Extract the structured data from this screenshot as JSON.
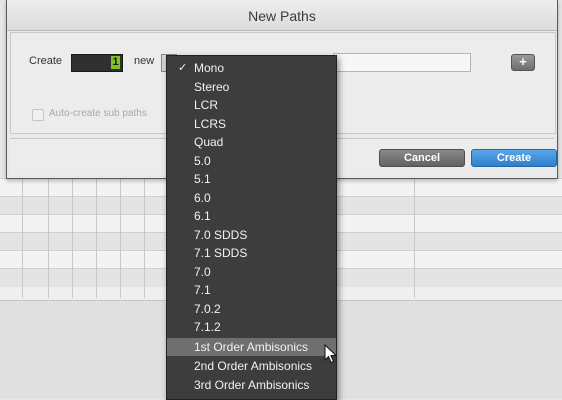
{
  "dialog": {
    "title": "New Paths",
    "create_label": "Create",
    "count_value": "1",
    "new_label": "new",
    "subpaths_label": "Auto-create sub paths",
    "add_button": "+",
    "cancel_label": "Cancel",
    "create_button_label": "Create"
  },
  "menu": {
    "selected": "Mono",
    "highlighted": "1st Order Ambisonics",
    "items": [
      {
        "label": "Mono",
        "checked": true
      },
      {
        "label": "Stereo"
      },
      {
        "label": "LCR"
      },
      {
        "label": "LCRS"
      },
      {
        "label": "Quad"
      },
      {
        "label": "5.0"
      },
      {
        "label": "5.1"
      },
      {
        "label": "6.0"
      },
      {
        "label": "6.1"
      },
      {
        "label": "7.0 SDDS"
      },
      {
        "label": "7.1 SDDS"
      },
      {
        "label": "7.0"
      },
      {
        "label": "7.1"
      },
      {
        "label": "7.0.2"
      },
      {
        "label": "7.1.2"
      },
      {
        "label": "1st Order Ambisonics"
      },
      {
        "label": "2nd Order Ambisonics"
      },
      {
        "label": "3rd Order Ambisonics"
      }
    ]
  },
  "colors": {
    "count_accent": "#7fc41d",
    "create_button": "#2f7fcf",
    "menu_background": "#3d3d3d",
    "menu_highlight": "#6f6f6f"
  },
  "icons": {
    "check": "checkmark-icon",
    "plus": "plus-icon",
    "cursor": "mouse-pointer-icon"
  }
}
